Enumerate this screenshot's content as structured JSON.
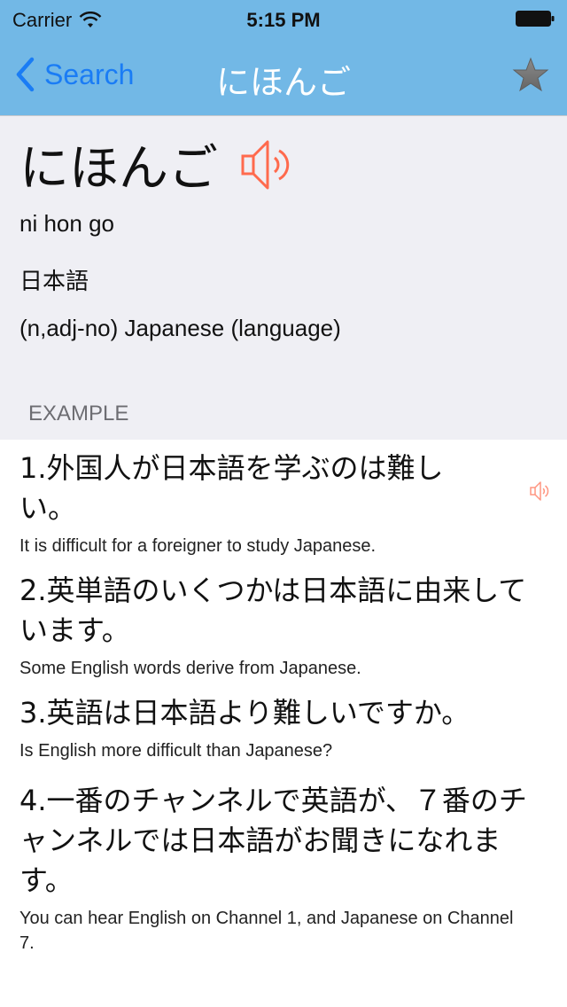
{
  "status_bar": {
    "carrier": "Carrier",
    "time": "5:15 PM",
    "wifi_icon": "wifi-icon",
    "battery_icon": "battery-icon"
  },
  "nav": {
    "back_label": "Search",
    "back_icon": "chevron-left-icon",
    "title": "にほんご",
    "favorite_icon": "star-icon"
  },
  "entry": {
    "word": "にほんご",
    "speaker_icon": "speaker-icon",
    "reading": "ni hon go",
    "kanji": "日本語",
    "meaning": "(n,adj-no) Japanese (language)"
  },
  "examples_section": {
    "label": "EXAMPLE",
    "items": [
      {
        "jp": "1.外国人が日本語を学ぶのは難しい。",
        "en": "It is difficult for a foreigner to study Japanese."
      },
      {
        "jp": "2.英単語のいくつかは日本語に由来しています。",
        "en": "Some English words derive from Japanese."
      },
      {
        "jp": "3.英語は日本語より難しいですか。",
        "en": "Is English more difficult than Japanese?"
      },
      {
        "jp": "4.一番のチャンネルで英語が、７番のチャンネルでは日本語がお聞きになれます。",
        "en": "You can hear English on Channel 1, and Japanese on Channel 7."
      }
    ]
  },
  "colors": {
    "header_bg": "#72b8e6",
    "link_blue": "#1a7cf5",
    "speaker_orange": "#ff6a4d",
    "detail_bg": "#efeff4",
    "star_gray": "#7a7a7a"
  }
}
